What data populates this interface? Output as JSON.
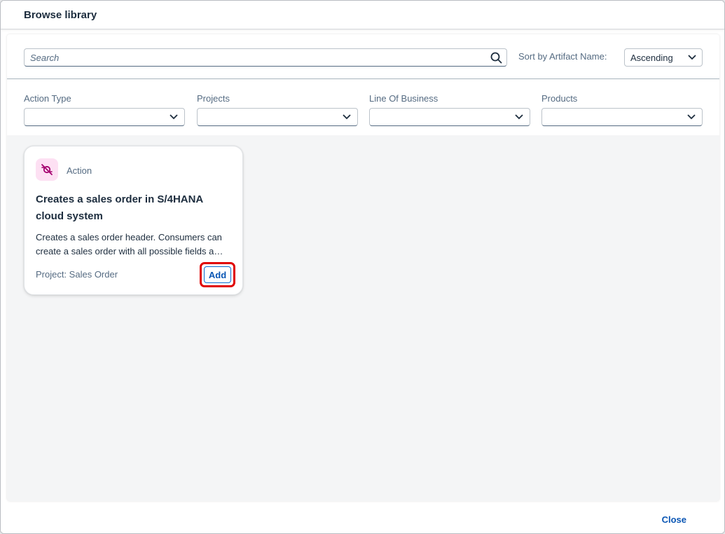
{
  "dialog": {
    "title": "Browse library",
    "close_label": "Close"
  },
  "toolbar": {
    "search_placeholder": "Search",
    "search_value": "",
    "sort_label": "Sort by Artifact Name:",
    "sort_value": "Ascending"
  },
  "filters": [
    {
      "label": "Action Type",
      "value": ""
    },
    {
      "label": "Projects",
      "value": ""
    },
    {
      "label": "Line Of Business",
      "value": ""
    },
    {
      "label": "Products",
      "value": ""
    }
  ],
  "cards": [
    {
      "icon": "action-icon",
      "type": "Action",
      "title": "Creates a sales order in S/4HANA cloud system",
      "description": "Creates a sales order header. Consumers can create a sales order with all possible fields and options.",
      "project": "Project: Sales Order",
      "add_label": "Add"
    }
  ],
  "colors": {
    "accent": "#0a56b4",
    "highlight": "#e00000",
    "icon_bg": "#fde0f3",
    "icon_fg": "#a4006e"
  }
}
